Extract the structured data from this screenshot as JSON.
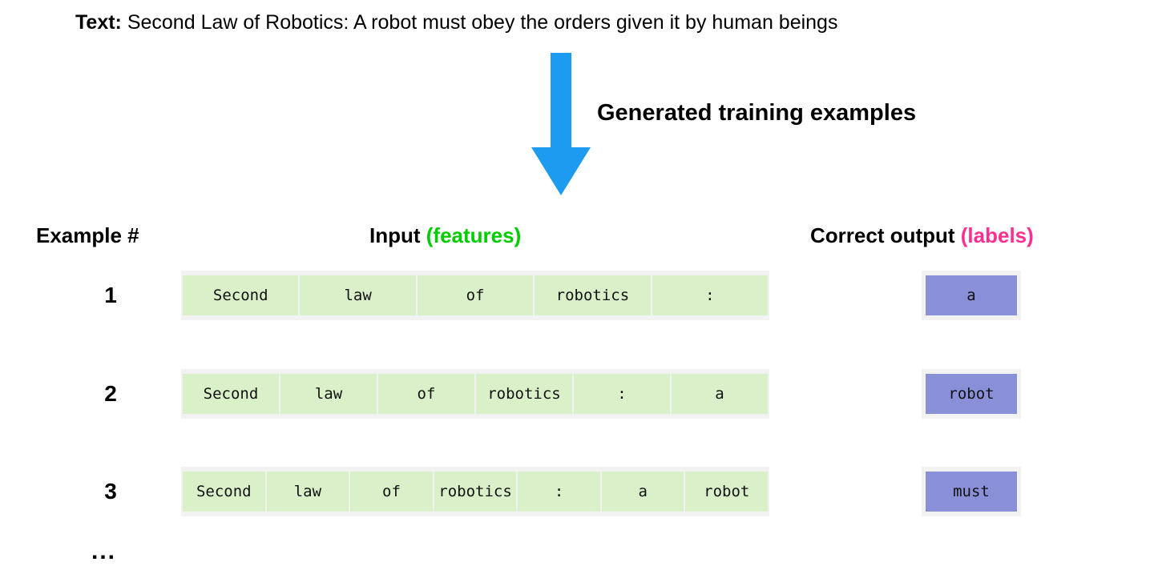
{
  "source_text": {
    "label": "Text:",
    "body": "Second Law of Robotics: A robot must obey the orders given it by human beings"
  },
  "arrow": {
    "name": "down-arrow-icon",
    "color": "#1c9bf0",
    "direction": "down"
  },
  "caption": {
    "text": "Generated training examples"
  },
  "headers": {
    "example": "Example #",
    "input_main": "Input ",
    "input_accent": "(features)",
    "output_main": "Correct output ",
    "output_accent": "(labels)"
  },
  "colors": {
    "feature_cell": "#daf0c9",
    "label_chip": "#8a90d8",
    "strip_frame": "#f2f2f2",
    "accent_green": "#00cc00",
    "accent_pink": "#ff2f92",
    "arrow_blue": "#1c9bf0"
  },
  "rows": [
    {
      "index": "1",
      "features": [
        "Second",
        "law",
        "of",
        "robotics",
        ":"
      ],
      "label": "a"
    },
    {
      "index": "2",
      "features": [
        "Second",
        "law",
        "of",
        "robotics",
        ":",
        "a"
      ],
      "label": "robot"
    },
    {
      "index": "3",
      "features": [
        "Second",
        "law",
        "of",
        "robotics",
        ":",
        "a",
        "robot"
      ],
      "label": "must"
    }
  ],
  "ellipsis": "..."
}
